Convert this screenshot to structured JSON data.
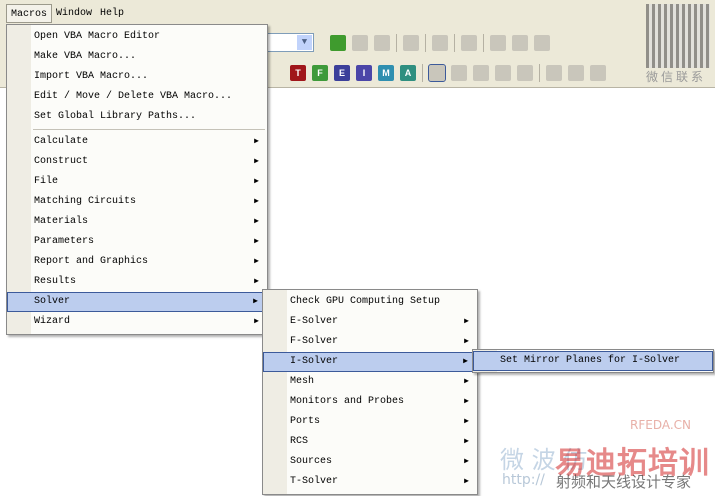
{
  "menubar": [
    "Macros",
    "Window",
    "Help"
  ],
  "macros_menu": {
    "group1": [
      "Open VBA Macro Editor",
      "Make VBA Macro...",
      "Import VBA Macro...",
      "Edit / Move / Delete VBA Macro...",
      "Set Global Library Paths..."
    ],
    "group2": [
      "Calculate",
      "Construct",
      "File",
      "Matching Circuits",
      "Materials",
      "Parameters",
      "Report and Graphics",
      "Results",
      "Solver",
      "Wizard"
    ]
  },
  "solver_menu": [
    "Check GPU Computing Setup",
    "E-Solver",
    "F-Solver",
    "I-Solver",
    "Mesh",
    "Monitors and Probes",
    "Ports",
    "RCS",
    "Sources",
    "T-Solver"
  ],
  "isolver_menu": [
    "Set Mirror Planes for I-Solver"
  ],
  "solver_toolbar": [
    "T",
    "F",
    "E",
    "I",
    "M",
    "A"
  ],
  "solver_colors": [
    "#a0161a",
    "#3e9a3a",
    "#3b3f9a",
    "#4b46a8",
    "#2f8fb0",
    "#2f8f80"
  ],
  "qr_caption": "微信联系",
  "watermark": {
    "site": "RFEDA.CN",
    "brand": "易迪拓培训",
    "tag": "射频和天线设计专家",
    "url": "http://",
    "chars": "微 波 仿"
  }
}
